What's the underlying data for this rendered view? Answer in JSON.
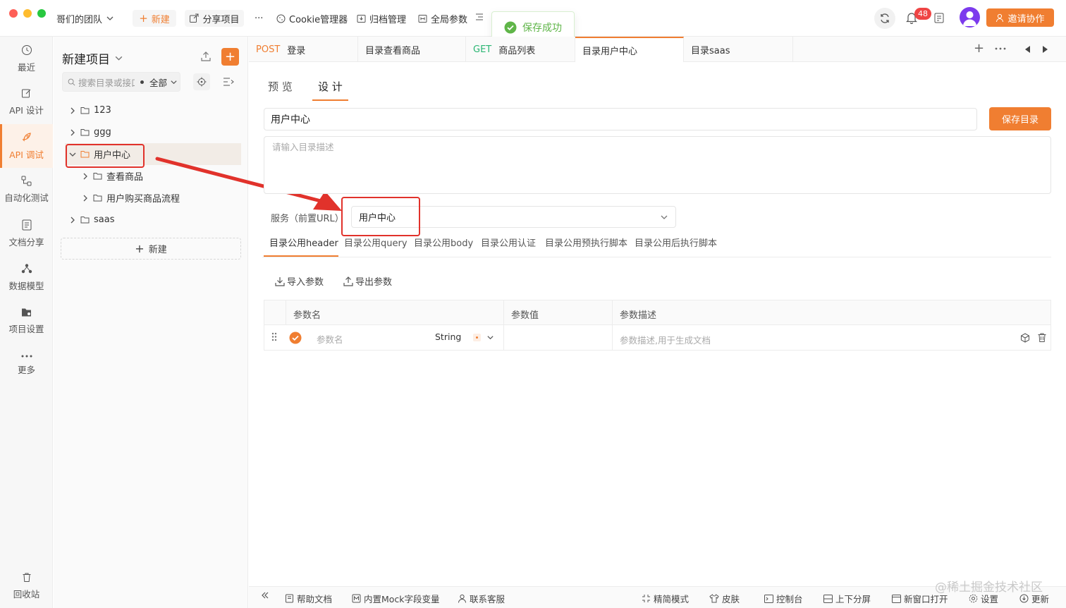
{
  "titlebar": {
    "team_name": "哥们的团队",
    "new_label": "新建",
    "share_label": "分享项目",
    "more_label": "···",
    "cookie_label": "Cookie管理器",
    "archive_label": "归档管理",
    "global_params_label": "全局参数",
    "notification_count": "48",
    "invite_label": "邀请协作"
  },
  "toast": {
    "text": "保存成功"
  },
  "rail": {
    "items": [
      {
        "label": "最近",
        "icon": "clock-icon"
      },
      {
        "label": "API 设计",
        "icon": "edit-icon"
      },
      {
        "label": "API 调试",
        "icon": "rocket-icon"
      },
      {
        "label": "自动化测试",
        "icon": "flow-icon"
      },
      {
        "label": "文档分享",
        "icon": "doc-icon"
      },
      {
        "label": "数据模型",
        "icon": "model-icon"
      },
      {
        "label": "项目设置",
        "icon": "folder-gear-icon"
      },
      {
        "label": "更多",
        "icon": "more-icon"
      }
    ],
    "trash_label": "回收站"
  },
  "tree": {
    "project_title": "新建项目",
    "search_placeholder": "搜索目录或接口",
    "filter_label": "全部",
    "items": [
      {
        "label": "123"
      },
      {
        "label": "ggg"
      },
      {
        "label": "用户中心"
      },
      {
        "label": "查看商品"
      },
      {
        "label": "用户购买商品流程"
      },
      {
        "label": "saas"
      }
    ],
    "new_label": "新建"
  },
  "tabs": [
    {
      "method": "POST",
      "label": "登录"
    },
    {
      "method": "",
      "label": "目录查看商品"
    },
    {
      "method": "GET",
      "label": "商品列表"
    },
    {
      "method": "",
      "label": "目录用户中心"
    },
    {
      "method": "",
      "label": "目录saas"
    }
  ],
  "editor": {
    "view_tabs": [
      "预 览",
      "设 计"
    ],
    "name_value": "用户中心",
    "save_label": "保存目录",
    "desc_placeholder": "请输入目录描述",
    "service_label": "服务（前置URL）",
    "service_value": "用户中心",
    "sub_tabs": [
      "目录公用header",
      "目录公用query",
      "目录公用body",
      "目录公用认证",
      "目录公用预执行脚本",
      "目录公用后执行脚本"
    ],
    "import_label": "导入参数",
    "export_label": "导出参数",
    "table": {
      "headers": [
        "参数名",
        "参数值",
        "参数描述"
      ],
      "row": {
        "name_placeholder": "参数名",
        "type": "String",
        "desc_placeholder": "参数描述,用于生成文档"
      }
    }
  },
  "bottombar": {
    "help": "帮助文档",
    "mock": "内置Mock字段变量",
    "service": "联系客服",
    "simple": "精简模式",
    "skin": "皮肤",
    "console": "控制台",
    "split": "上下分屏",
    "new_window": "新窗口打开",
    "settings": "设置",
    "update": "更新"
  },
  "watermark": "@稀土掘金技术社区",
  "colors": {
    "accent": "#f07e31",
    "annotation_red": "#e1322b",
    "success": "#5fb548",
    "get": "#2bb673"
  }
}
